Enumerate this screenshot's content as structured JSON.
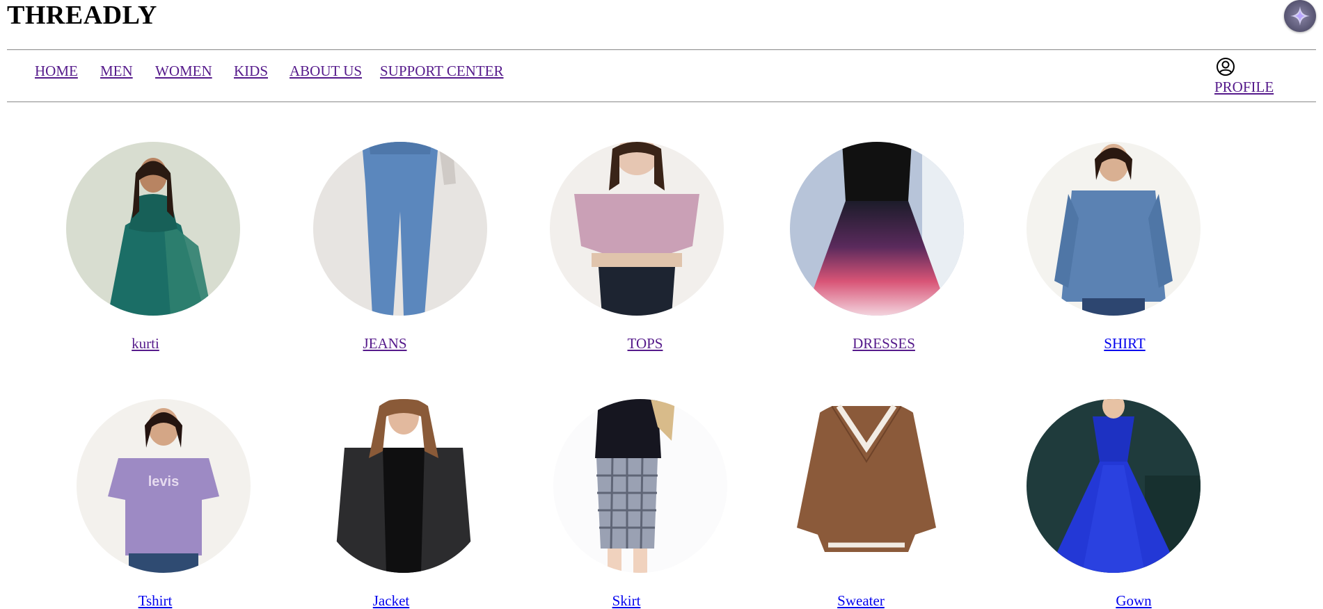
{
  "brand": {
    "name": "THREADLY"
  },
  "assistant": {
    "icon": "sparkle-icon"
  },
  "nav": {
    "items": [
      {
        "label": "HOME"
      },
      {
        "label": "MEN"
      },
      {
        "label": "WOMEN"
      },
      {
        "label": "KIDS"
      },
      {
        "label": "ABOUT US"
      },
      {
        "label": "SUPPORT CENTER"
      }
    ],
    "profile": {
      "label": "PROFILE",
      "icon": "user-circle-icon"
    }
  },
  "categories": [
    {
      "label": "kurti"
    },
    {
      "label": "JEANS"
    },
    {
      "label": "TOPS"
    },
    {
      "label": "DRESSES"
    },
    {
      "label": "SHIRT"
    },
    {
      "label": "Tshirt"
    },
    {
      "label": "Jacket"
    },
    {
      "label": "Skirt"
    },
    {
      "label": "Sweater"
    },
    {
      "label": "Gown"
    }
  ],
  "colors": {
    "link_visited": "#551a8b",
    "link_unvisited": "#0000ee",
    "rule": "#888888"
  }
}
